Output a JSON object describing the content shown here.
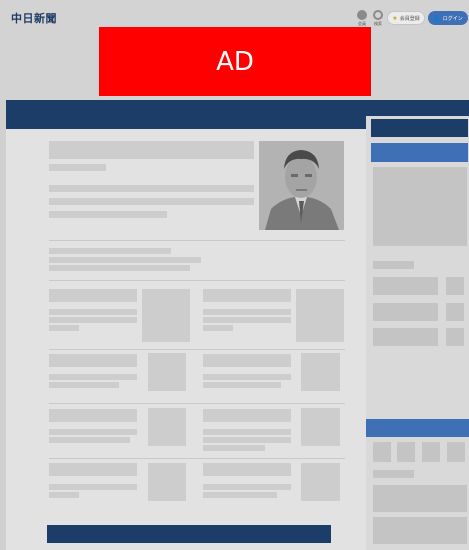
{
  "header": {
    "logo_text": "中日新聞",
    "icons": [
      {
        "name": "account-icon",
        "label": "会員"
      },
      {
        "name": "search-icon",
        "label": "検索"
      }
    ],
    "register_button": {
      "icon": "star-icon",
      "label": "会員登録"
    },
    "login_button": {
      "icon": "person-icon",
      "label": "ログイン"
    }
  },
  "ad": {
    "label": "AD"
  },
  "colors": {
    "brand_navy": "#1d3d69",
    "accent_blue": "#3f70b6",
    "ad_red": "#ff0000"
  }
}
